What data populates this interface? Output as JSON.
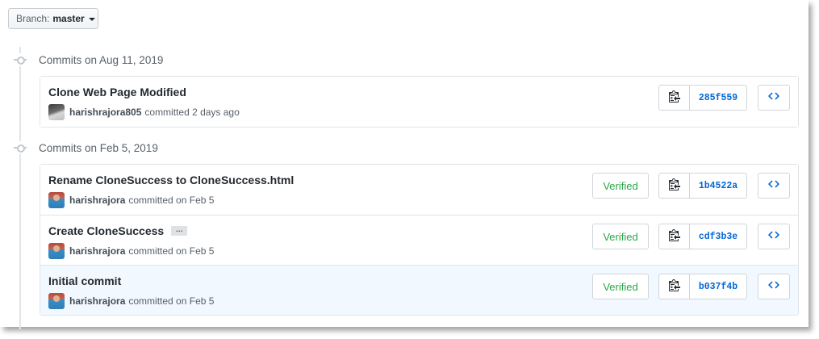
{
  "branch": {
    "label": "Branch:",
    "value": "master"
  },
  "groups": [
    {
      "date": "Commits on Aug 11, 2019",
      "commits": [
        {
          "title": "Clone Web Page Modified",
          "author": "harishrajora805",
          "time": "committed 2 days ago",
          "verified": "",
          "sha": "285f559"
        }
      ]
    },
    {
      "date": "Commits on Feb 5, 2019",
      "commits": [
        {
          "title": "Rename CloneSuccess to CloneSuccess.html",
          "author": "harishrajora",
          "time": "committed on Feb 5",
          "verified": "Verified",
          "sha": "1b4522a"
        },
        {
          "title": "Create CloneSuccess",
          "ellipsis": "…",
          "author": "harishrajora",
          "time": "committed on Feb 5",
          "verified": "Verified",
          "sha": "cdf3b3e"
        },
        {
          "title": "Initial commit",
          "author": "harishrajora",
          "time": "committed on Feb 5",
          "verified": "Verified",
          "sha": "b037f4b"
        }
      ]
    }
  ],
  "icons": {
    "copy": "clipboard-icon",
    "browse": "code-icon",
    "timeline": "commit-node-icon",
    "dropdown": "caret-down-icon"
  },
  "colors": {
    "sha": "#0366d6",
    "verified": "#28a745",
    "highlight": "#f1f8ff"
  }
}
